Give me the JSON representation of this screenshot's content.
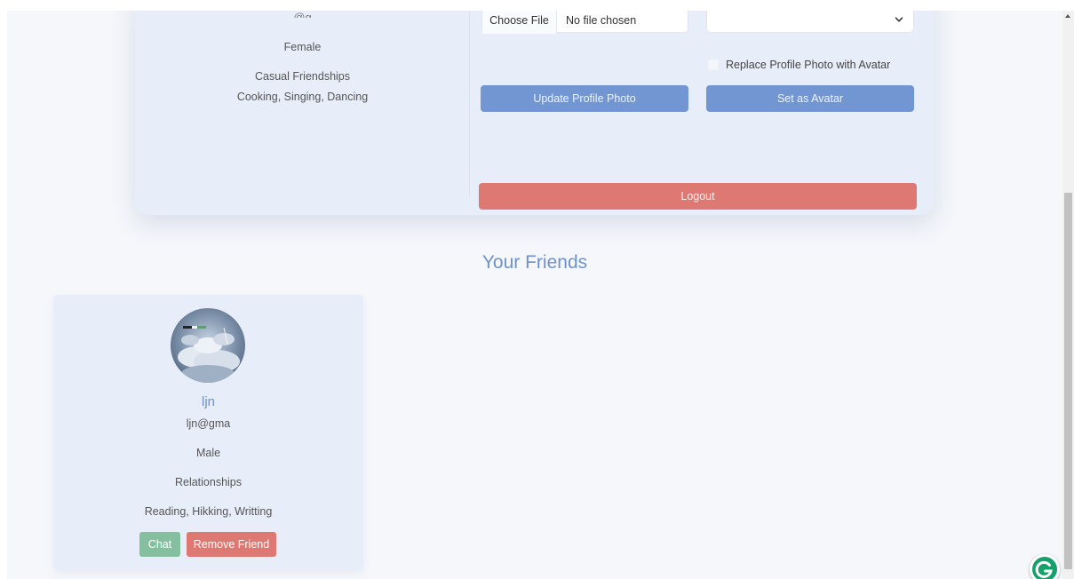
{
  "profile": {
    "email_partial": "@g",
    "gender": "Female",
    "looking_for": "Casual Friendships",
    "interests": "Cooking, Singing, Dancing"
  },
  "upload": {
    "choose_file_label": "Choose File",
    "file_status": "No file chosen"
  },
  "avatar_select": {
    "selected": ""
  },
  "replace_checkbox_label": "Replace Profile Photo with Avatar",
  "buttons": {
    "update_photo": "Update Profile Photo",
    "set_avatar": "Set as Avatar",
    "logout": "Logout"
  },
  "friends": {
    "title": "Your Friends",
    "list": [
      {
        "name": "ljn",
        "email": "ljn@gma",
        "gender": "Male",
        "looking_for": "Relationships",
        "interests": "Reading, Hikking, Writting",
        "chat_label": "Chat",
        "remove_label": "Remove Friend"
      }
    ]
  },
  "colors": {
    "page_bg": "#f5f7fb",
    "card_bg": "#e8eef9",
    "accent_blue": "#7196d1",
    "danger_red": "#dd7872",
    "success_green": "#84bfa0",
    "title_blue": "#6f92c9"
  },
  "icons": {
    "select_chevron": "chevron-down-icon",
    "grammarly": "grammarly-icon"
  }
}
